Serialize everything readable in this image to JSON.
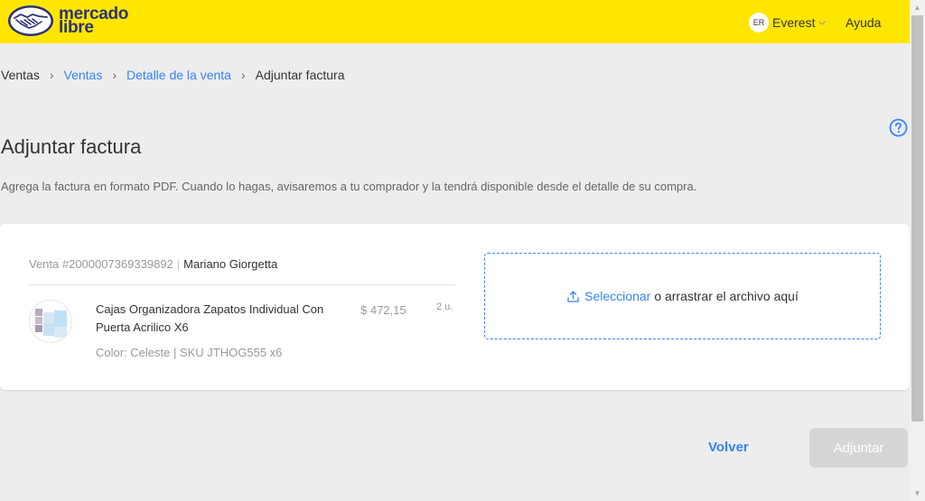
{
  "header": {
    "logo_line1": "mercado",
    "logo_line2": "libre",
    "user_initials": "ER",
    "user_name": "Everest",
    "help_label": "Ayuda"
  },
  "breadcrumb": {
    "items": [
      "Ventas",
      "Ventas",
      "Detalle de la venta",
      "Adjuntar factura"
    ]
  },
  "page": {
    "title": "Adjuntar factura",
    "subtitle": "Agrega la factura en formato PDF. Cuando lo hagas, avisaremos a tu comprador y la tendrá disponible desde el detalle de su compra."
  },
  "sale": {
    "id_label": "Venta #2000007369339892",
    "buyer": "Mariano Giorgetta",
    "product_title": "Cajas Organizadora Zapatos Individual Con Puerta Acrilico X6",
    "product_meta": "Color: Celeste | SKU JTHOG555 x6",
    "price": "$ 472,15",
    "quantity": "2 u."
  },
  "upload": {
    "link_label": "Seleccionar",
    "rest_label": "o arrastrar el archivo aquí"
  },
  "actions": {
    "back_label": "Volver",
    "submit_label": "Adjuntar"
  },
  "colors": {
    "header_bg": "#ffe600",
    "accent": "#3483fa",
    "disabled_btn": "#d6d6d6"
  }
}
